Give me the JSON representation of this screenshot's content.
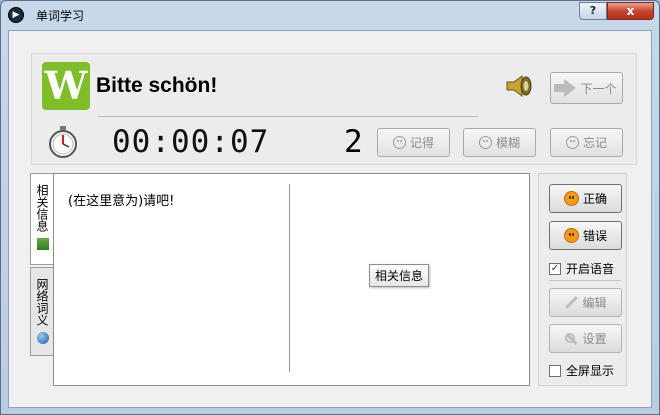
{
  "window": {
    "title": "单词学习",
    "help_label": "?",
    "close_label": "x"
  },
  "header": {
    "logo_letter": "W",
    "word": "Bitte schön!",
    "next_label": "下一个"
  },
  "timer": {
    "time": "00:00:07",
    "count": "2"
  },
  "rating_buttons": {
    "remember": "记得",
    "fuzzy": "模糊",
    "forget": "忘记"
  },
  "tabs": [
    {
      "label": "相关信息"
    },
    {
      "label": "网络词义"
    }
  ],
  "content": {
    "translation": "(在这里意为)请吧!",
    "info_label": "相关信息"
  },
  "side": {
    "correct": "正确",
    "wrong": "错误",
    "voice": {
      "label": "开启语音",
      "checked": true
    },
    "edit": "编辑",
    "settings": "设置",
    "fullscreen": {
      "label": "全屏显示",
      "checked": false
    }
  }
}
